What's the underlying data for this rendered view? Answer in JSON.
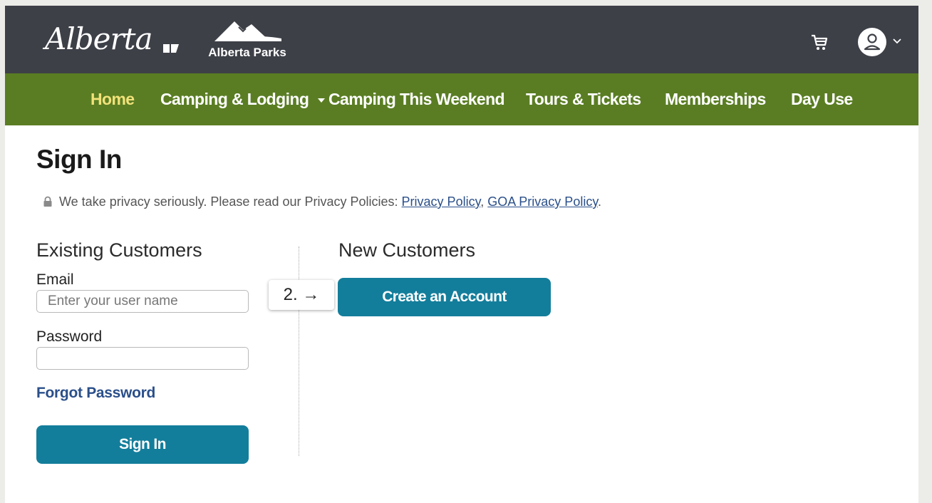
{
  "header": {
    "alberta_logo_text": "Alberta",
    "parks_logo_text": "Alberta Parks"
  },
  "nav": {
    "items": [
      {
        "label": "Home",
        "active": true
      },
      {
        "label": "Camping & Lodging",
        "has_dropdown": true
      },
      {
        "label": "Camping This Weekend"
      },
      {
        "label": "Tours & Tickets"
      },
      {
        "label": "Memberships"
      },
      {
        "label": "Day Use"
      }
    ]
  },
  "page": {
    "title": "Sign In",
    "privacy": {
      "text": "We take privacy seriously. Please read our Privacy Policies:",
      "link1": "Privacy Policy",
      "separator": ",",
      "link2": "GOA Privacy Policy",
      "end": "."
    }
  },
  "existing": {
    "title": "Existing Customers",
    "email_label": "Email",
    "email_placeholder": "Enter your user name",
    "password_label": "Password",
    "forgot": "Forgot Password",
    "signin_button": "Sign In"
  },
  "new_customers": {
    "title": "New Customers",
    "create_button": "Create an Account"
  },
  "annotation": {
    "step_label": "2. →"
  },
  "colors": {
    "topbar": "#3e4048",
    "nav": "#5a7d23",
    "nav_active": "#f2e27a",
    "button": "#137e9b",
    "link": "#2a4f8a"
  },
  "icons": [
    "lock-icon",
    "cart-icon",
    "user-icon",
    "chevron-down-icon",
    "caret-down-icon"
  ]
}
